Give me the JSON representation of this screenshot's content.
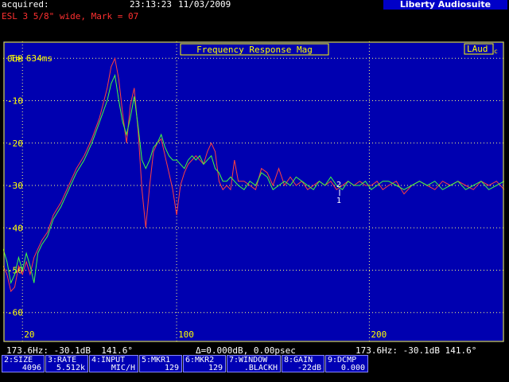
{
  "header": {
    "acquired_label": "acquired:",
    "time": "23:13:23",
    "date": "11/03/2009",
    "brand": "Liberty Audiosuite"
  },
  "subtitle": "ESL 3 5/8\" wide, Mark = 07",
  "plot": {
    "title": "Frequency Response Mag",
    "t_label": "T= 634ms",
    "laud": "LAud",
    "laud_sub": "c",
    "marker2": "2",
    "marker1": "1",
    "background": "#0000b0",
    "grid_color": "#ffff80",
    "label_color": "#ffff00",
    "frame_color": "#ffff00"
  },
  "chart_data": {
    "type": "line",
    "title": "Frequency Response Mag",
    "xlabel": "",
    "ylabel": "",
    "xlim": [
      10,
      270
    ],
    "ylim": [
      -67,
      4
    ],
    "x_ticks": [
      20,
      100,
      200
    ],
    "x_tick_labels": [
      "20",
      "100",
      "200"
    ],
    "y_ticks": [
      0,
      -10,
      -20,
      -30,
      -40,
      -50,
      -60
    ],
    "y_tick_labels": [
      "0dB",
      "-10",
      "-20",
      "-30",
      "-40",
      "-50",
      "-60"
    ],
    "grid": true,
    "series": [
      {
        "color": "#ff4040",
        "x": [
          10,
          12,
          14,
          16,
          18,
          20,
          22,
          24,
          26,
          28,
          30,
          33,
          36,
          40,
          44,
          48,
          52,
          56,
          60,
          64,
          66,
          68,
          70,
          72,
          74,
          76,
          78,
          80,
          82,
          84,
          86,
          88,
          90,
          92,
          94,
          96,
          98,
          100,
          102,
          104,
          106,
          108,
          110,
          112,
          114,
          116,
          118,
          120,
          122,
          124,
          126,
          128,
          130,
          132,
          135,
          138,
          141,
          144,
          147,
          150,
          153,
          156,
          159,
          162,
          165,
          168,
          171,
          174,
          177,
          180,
          183,
          186,
          189,
          192,
          195,
          198,
          201,
          204,
          207,
          210,
          214,
          218,
          222,
          226,
          230,
          234,
          238,
          242,
          246,
          250,
          254,
          258,
          262,
          266,
          270
        ],
        "y": [
          -49,
          -51,
          -55,
          -54,
          -49,
          -51,
          -48,
          -51,
          -47,
          -45,
          -43,
          -41,
          -37,
          -34,
          -30,
          -26,
          -23,
          -19,
          -14,
          -7,
          -2,
          0,
          -5,
          -13,
          -20,
          -11,
          -7,
          -17,
          -31,
          -40,
          -30,
          -22,
          -20,
          -19,
          -23,
          -27,
          -31,
          -37,
          -30,
          -27,
          -25,
          -24,
          -23,
          -24,
          -25,
          -22,
          -20,
          -22,
          -29,
          -31,
          -30,
          -31,
          -24,
          -29,
          -29,
          -30,
          -31,
          -26,
          -27,
          -30,
          -26,
          -30,
          -28,
          -30,
          -29,
          -31,
          -30,
          -29,
          -30,
          -29,
          -31,
          -30,
          -29,
          -30,
          -29,
          -30,
          -30,
          -29,
          -31,
          -30,
          -29,
          -32,
          -30,
          -29,
          -30,
          -31,
          -29,
          -30,
          -29,
          -30,
          -31,
          -29,
          -30,
          -29,
          -31
        ]
      },
      {
        "color": "#40ff40",
        "x": [
          10,
          12,
          14,
          16,
          18,
          20,
          22,
          24,
          26,
          28,
          30,
          33,
          36,
          40,
          44,
          48,
          52,
          56,
          60,
          64,
          66,
          68,
          70,
          72,
          74,
          76,
          78,
          80,
          82,
          84,
          86,
          88,
          90,
          92,
          94,
          96,
          98,
          100,
          102,
          104,
          106,
          108,
          110,
          112,
          114,
          116,
          118,
          120,
          122,
          124,
          126,
          128,
          130,
          132,
          135,
          138,
          141,
          144,
          147,
          150,
          153,
          156,
          159,
          162,
          165,
          168,
          171,
          174,
          177,
          180,
          183,
          186,
          189,
          192,
          195,
          198,
          201,
          204,
          207,
          210,
          214,
          218,
          222,
          226,
          230,
          234,
          238,
          242,
          246,
          250,
          254,
          258,
          262,
          266,
          270
        ],
        "y": [
          -45,
          -48,
          -53,
          -51,
          -47,
          -50,
          -46,
          -49,
          -53,
          -46,
          -44,
          -42,
          -38,
          -35,
          -31,
          -27,
          -24,
          -20,
          -15,
          -10,
          -6,
          -4,
          -10,
          -15,
          -18,
          -14,
          -9,
          -16,
          -24,
          -26,
          -24,
          -21,
          -20,
          -18,
          -21,
          -23,
          -24,
          -24,
          -25,
          -26,
          -24,
          -23,
          -24,
          -23,
          -25,
          -24,
          -23,
          -26,
          -27,
          -29,
          -29,
          -28,
          -29,
          -30,
          -31,
          -29,
          -30,
          -27,
          -28,
          -31,
          -30,
          -29,
          -30,
          -28,
          -29,
          -30,
          -31,
          -29,
          -30,
          -28,
          -30,
          -31,
          -29,
          -30,
          -30,
          -29,
          -31,
          -30,
          -29,
          -29,
          -30,
          -31,
          -30,
          -29,
          -30,
          -29,
          -31,
          -30,
          -29,
          -31,
          -30,
          -29,
          -31,
          -30,
          -29
        ]
      }
    ]
  },
  "status": {
    "left": "173.6Hz: -30.1dB  141.6°",
    "center": "Δ=0.000dB, 0.00psec",
    "right": "173.6Hz: -30.1dB 141.6°"
  },
  "fkeys": [
    {
      "label": "2:SIZE",
      "value": "4096"
    },
    {
      "label": "3:RATE",
      "value": "5.512k"
    },
    {
      "label": "4:INPUT",
      "value": "MIC/H"
    },
    {
      "label": "5:MKR1",
      "value": "129"
    },
    {
      "label": "6:MKR2",
      "value": "129"
    },
    {
      "label": "7:WINDOW",
      "value": ".BLACKH"
    },
    {
      "label": "8:GAIN",
      "value": "-22dB"
    },
    {
      "label": "9:DCMP",
      "value": "0.000"
    }
  ]
}
